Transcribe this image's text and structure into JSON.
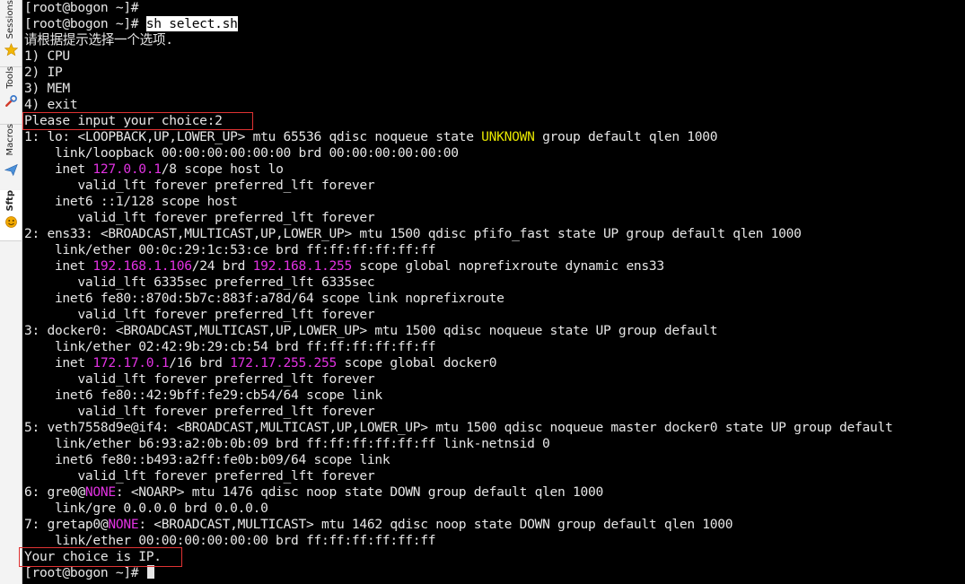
{
  "sidebar": {
    "tabs": [
      {
        "label": "Sessions",
        "icon": "star-icon"
      },
      {
        "label": "Tools",
        "icon": "tools-icon"
      },
      {
        "label": "Macros",
        "icon": "macros-icon"
      },
      {
        "label": "Sftp",
        "icon": "sftp-icon"
      }
    ]
  },
  "colors": {
    "background": "#000000",
    "foreground": "#e6e6e6",
    "magenta": "#e232e2",
    "yellow": "#e5e500",
    "highlight_box": "#e03333"
  },
  "terminal": {
    "lines": [
      [
        {
          "t": "[root@bogon ~]#"
        }
      ],
      [
        {
          "t": "[root@bogon ~]# "
        },
        {
          "t": "sh select.sh",
          "c": "sel"
        }
      ],
      [
        {
          "t": "请根据提示选择一个选项."
        }
      ],
      [
        {
          "t": "1) CPU"
        }
      ],
      [
        {
          "t": "2) IP"
        }
      ],
      [
        {
          "t": "3) MEM"
        }
      ],
      [
        {
          "t": "4) exit"
        }
      ],
      [
        {
          "t": "Please input your choice:2"
        }
      ],
      [
        {
          "t": "1: lo: <LOOPBACK,UP,LOWER_UP> mtu 65536 qdisc noqueue state "
        },
        {
          "t": "UNKNOWN",
          "c": "yel"
        },
        {
          "t": " group default qlen 1000"
        }
      ],
      [
        {
          "t": "    link/loopback 00:00:00:00:00:00 brd 00:00:00:00:00:00"
        }
      ],
      [
        {
          "t": "    inet "
        },
        {
          "t": "127.0.0.1",
          "c": "mag"
        },
        {
          "t": "/8 scope host lo"
        }
      ],
      [
        {
          "t": "       valid_lft forever preferred_lft forever"
        }
      ],
      [
        {
          "t": "    inet6 ::1/128 scope host"
        }
      ],
      [
        {
          "t": "       valid_lft forever preferred_lft forever"
        }
      ],
      [
        {
          "t": "2: ens33: <BROADCAST,MULTICAST,UP,LOWER_UP> mtu 1500 qdisc pfifo_fast state UP group default qlen 1000"
        }
      ],
      [
        {
          "t": "    link/ether 00:0c:29:1c:53:ce brd ff:ff:ff:ff:ff:ff"
        }
      ],
      [
        {
          "t": "    inet "
        },
        {
          "t": "192.168.1.106",
          "c": "mag"
        },
        {
          "t": "/24 brd "
        },
        {
          "t": "192.168.1.255",
          "c": "mag"
        },
        {
          "t": " scope global noprefixroute dynamic ens33"
        }
      ],
      [
        {
          "t": "       valid_lft 6335sec preferred_lft 6335sec"
        }
      ],
      [
        {
          "t": "    inet6 fe80::870d:5b7c:883f:a78d/64 scope link noprefixroute"
        }
      ],
      [
        {
          "t": "       valid_lft forever preferred_lft forever"
        }
      ],
      [
        {
          "t": "3: docker0: <BROADCAST,MULTICAST,UP,LOWER_UP> mtu 1500 qdisc noqueue state UP group default"
        }
      ],
      [
        {
          "t": "    link/ether 02:42:9b:29:cb:54 brd ff:ff:ff:ff:ff:ff"
        }
      ],
      [
        {
          "t": "    inet "
        },
        {
          "t": "172.17.0.1",
          "c": "mag"
        },
        {
          "t": "/16 brd "
        },
        {
          "t": "172.17.255.255",
          "c": "mag"
        },
        {
          "t": " scope global docker0"
        }
      ],
      [
        {
          "t": "       valid_lft forever preferred_lft forever"
        }
      ],
      [
        {
          "t": "    inet6 fe80::42:9bff:fe29:cb54/64 scope link"
        }
      ],
      [
        {
          "t": "       valid_lft forever preferred_lft forever"
        }
      ],
      [
        {
          "t": "5: veth7558d9e@if4: <BROADCAST,MULTICAST,UP,LOWER_UP> mtu 1500 qdisc noqueue master docker0 state UP group default"
        }
      ],
      [
        {
          "t": "    link/ether b6:93:a2:0b:0b:09 brd ff:ff:ff:ff:ff:ff link-netnsid 0"
        }
      ],
      [
        {
          "t": "    inet6 fe80::b493:a2ff:fe0b:b09/64 scope link"
        }
      ],
      [
        {
          "t": "       valid_lft forever preferred_lft forever"
        }
      ],
      [
        {
          "t": "6: gre0@"
        },
        {
          "t": "NONE",
          "c": "mag"
        },
        {
          "t": ": <NOARP> mtu 1476 qdisc noop state DOWN group default qlen 1000"
        }
      ],
      [
        {
          "t": "    link/gre 0.0.0.0 brd 0.0.0.0"
        }
      ],
      [
        {
          "t": "7: gretap0@"
        },
        {
          "t": "NONE",
          "c": "mag"
        },
        {
          "t": ": <BROADCAST,MULTICAST> mtu 1462 qdisc noop state DOWN group default qlen 1000"
        }
      ],
      [
        {
          "t": "    link/ether 00:00:00:00:00:00 brd ff:ff:ff:ff:ff:ff"
        }
      ],
      [
        {
          "t": "Your choice is IP."
        }
      ],
      [
        {
          "t": "[root@bogon ~]# "
        }
      ]
    ]
  }
}
